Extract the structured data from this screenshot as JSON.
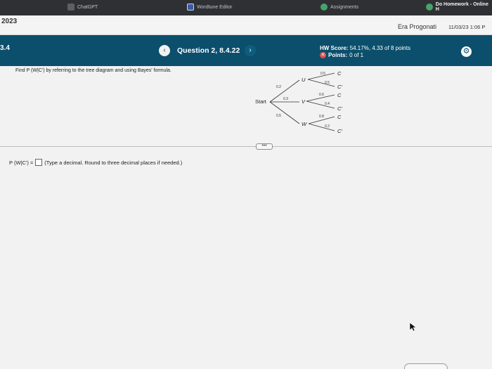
{
  "browser_tabs": [
    {
      "label": "ChatGPT"
    },
    {
      "label": "Wordtune Editor"
    },
    {
      "label": "Assignments"
    },
    {
      "label": "Do Homework - Online H"
    }
  ],
  "header": {
    "year": "2023",
    "user_name": "Era Progonati",
    "datetime": "11/03/23 1:06 P"
  },
  "question_bar": {
    "section": "3.4",
    "prev_label": "‹",
    "title": "Question 2, 8.4.22",
    "next_label": "›",
    "hw_score_label": "HW Score:",
    "hw_score_value": "54.17%, 4.33 of 8 points",
    "points_label": "Points:",
    "points_value": "0 of 1"
  },
  "question": {
    "prompt": "Find P (W|C') by referring to the tree diagram and using Bayes' formula."
  },
  "tree": {
    "start_label": "Start",
    "first_level": [
      {
        "node": "U",
        "prob": "0.2"
      },
      {
        "node": "V",
        "prob": "0.3"
      },
      {
        "node": "W",
        "prob": "0.5"
      }
    ],
    "second_level": [
      {
        "parent": "U",
        "outcome": "C",
        "prob": "0.5"
      },
      {
        "parent": "U",
        "outcome": "C'",
        "prob": "0.5"
      },
      {
        "parent": "V",
        "outcome": "C",
        "prob": "0.6"
      },
      {
        "parent": "V",
        "outcome": "C'",
        "prob": "0.4"
      },
      {
        "parent": "W",
        "outcome": "C",
        "prob": "0.8"
      },
      {
        "parent": "W",
        "outcome": "C'",
        "prob": "0.2"
      }
    ]
  },
  "expand_label": "•••",
  "answer": {
    "label": "P (W|C') =",
    "instruction": "(Type a decimal. Round to three decimal places if needed.)"
  },
  "colors": {
    "question_bar": "#0b4f6c",
    "browser_tabs": "#2f3033",
    "error_icon": "#d9534f"
  }
}
